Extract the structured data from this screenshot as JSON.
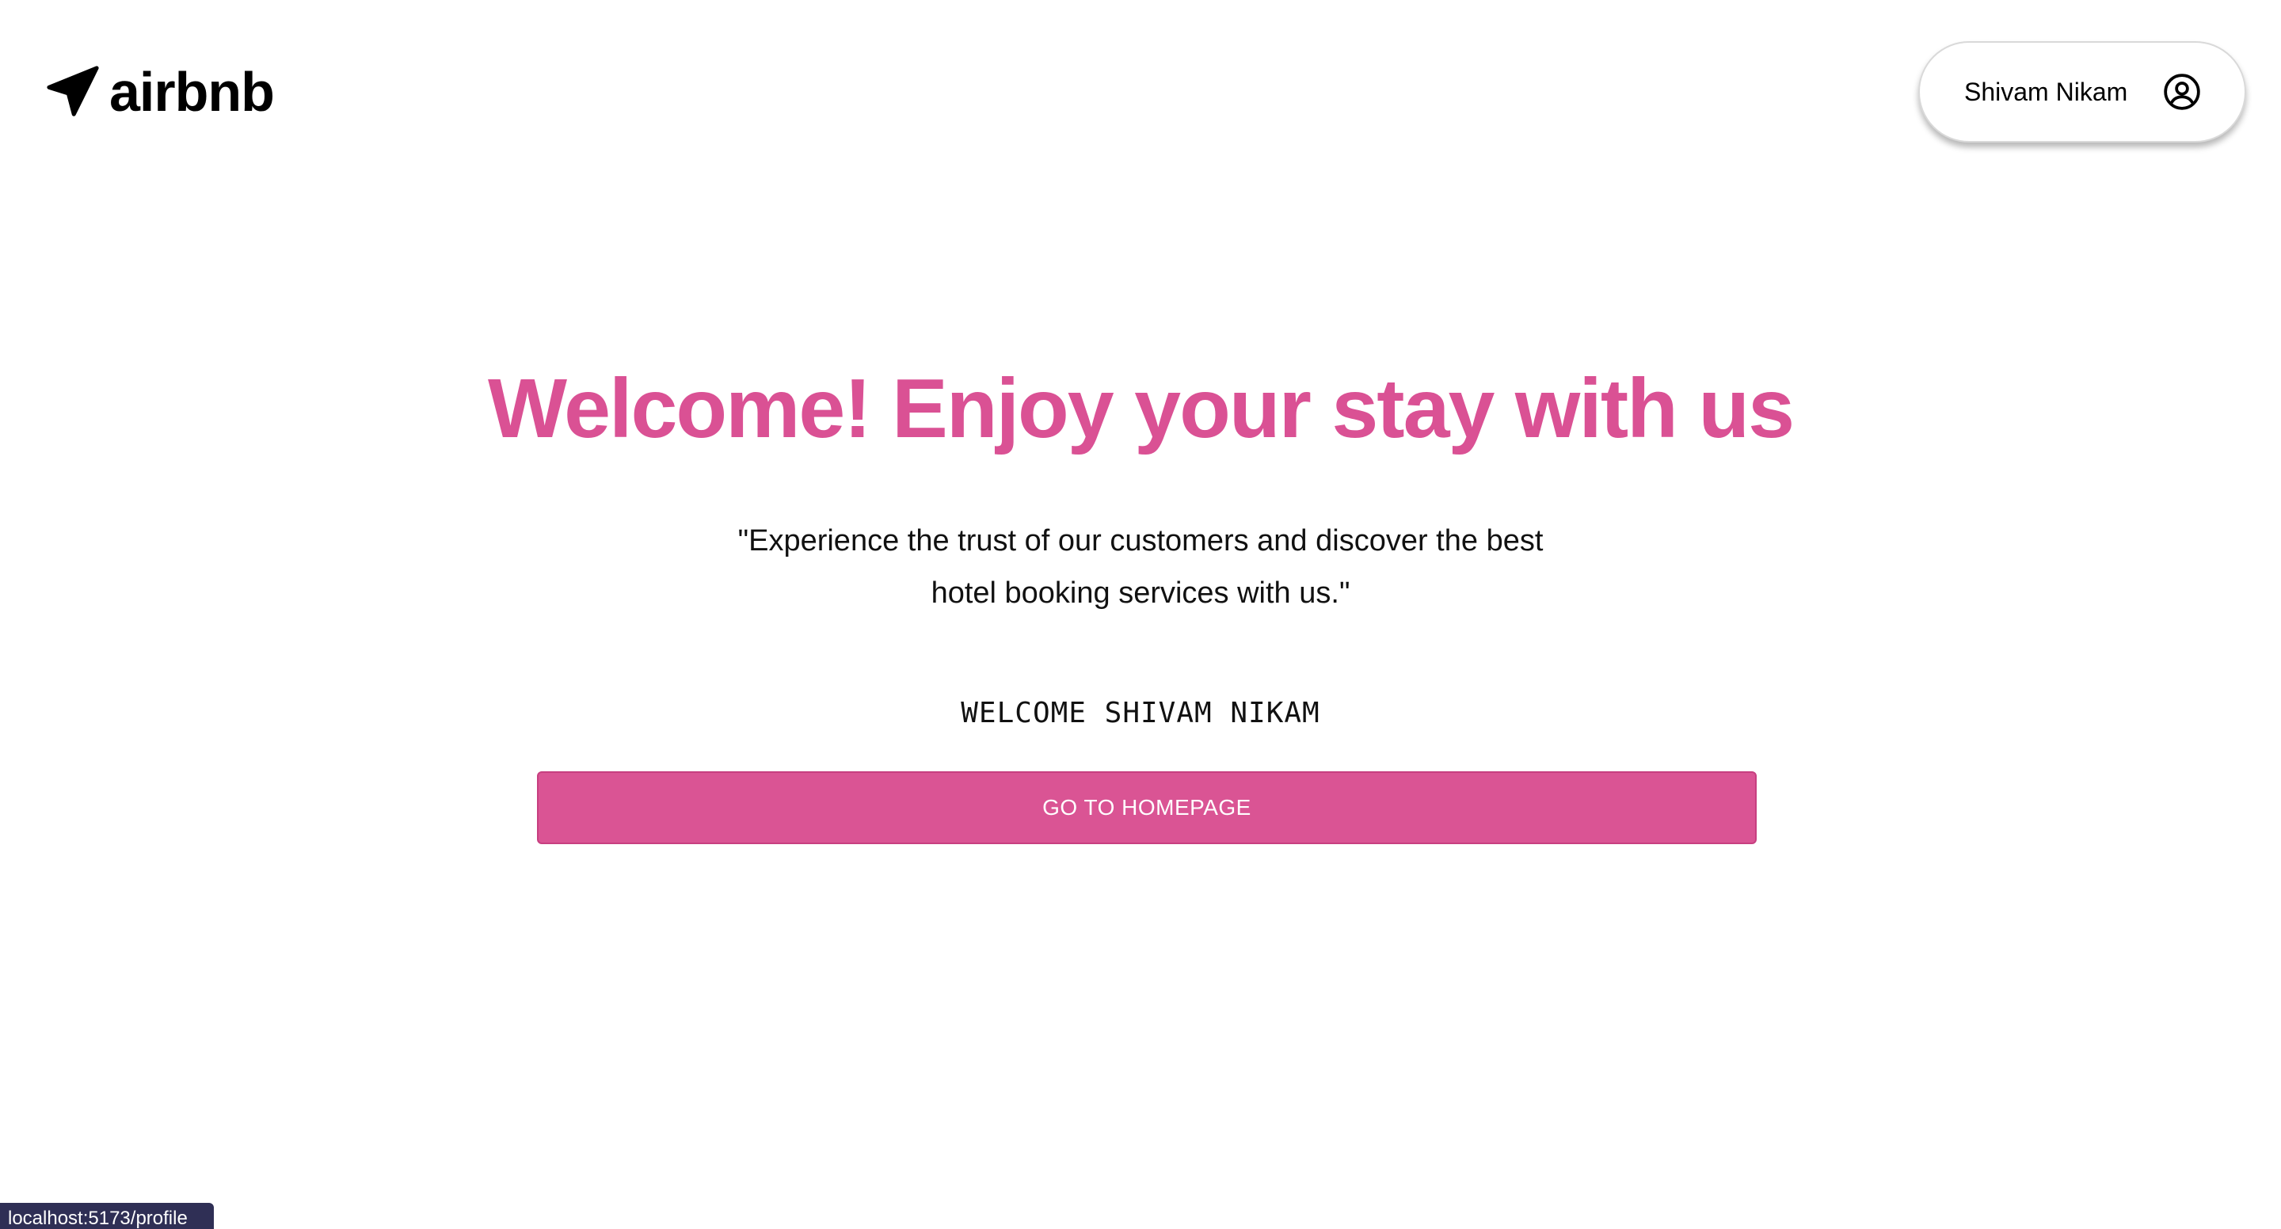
{
  "header": {
    "logo_text": "airbnb",
    "logo_icon": "navigation-arrow-icon",
    "user_name": "Shivam Nikam",
    "user_icon": "user-circle-icon"
  },
  "main": {
    "headline": "Welcome! Enjoy your stay with us",
    "quote_line1": "\"Experience the trust of our customers and discover the best",
    "quote_line2": "hotel booking services with us.\"",
    "welcome_user": "WELCOME SHIVAM NIKAM",
    "cta_label": "GO TO HOMEPAGE"
  },
  "status_bar": {
    "url": "localhost:5173/profile"
  },
  "colors": {
    "accent": "#da5194",
    "button": "#da5494",
    "status_bg": "#2f2f55"
  }
}
